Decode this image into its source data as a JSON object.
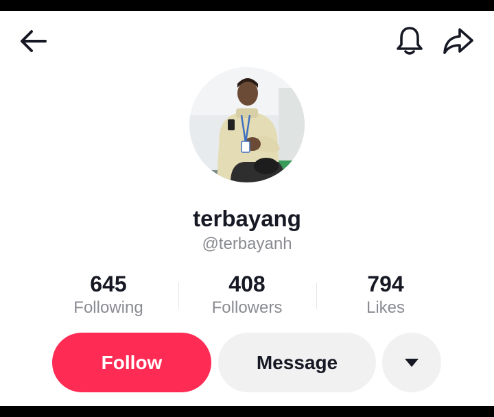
{
  "topbar": {
    "back_icon": "arrow-left-icon",
    "notification_icon": "bell-icon",
    "share_icon": "share-arrow-icon"
  },
  "profile": {
    "display_name": "terbayang",
    "username": "@terbayanh",
    "avatar_icon": "avatar-photo"
  },
  "stats": [
    {
      "value": "645",
      "label": "Following"
    },
    {
      "value": "408",
      "label": "Followers"
    },
    {
      "value": "794",
      "label": "Likes"
    }
  ],
  "actions": {
    "follow_label": "Follow",
    "message_label": "Message",
    "more_icon": "caret-down-icon"
  },
  "colors": {
    "follow_bg": "#fe2c55",
    "secondary_bg": "#f1f1f2",
    "text_primary": "#161823",
    "text_secondary": "#8a8b91"
  }
}
